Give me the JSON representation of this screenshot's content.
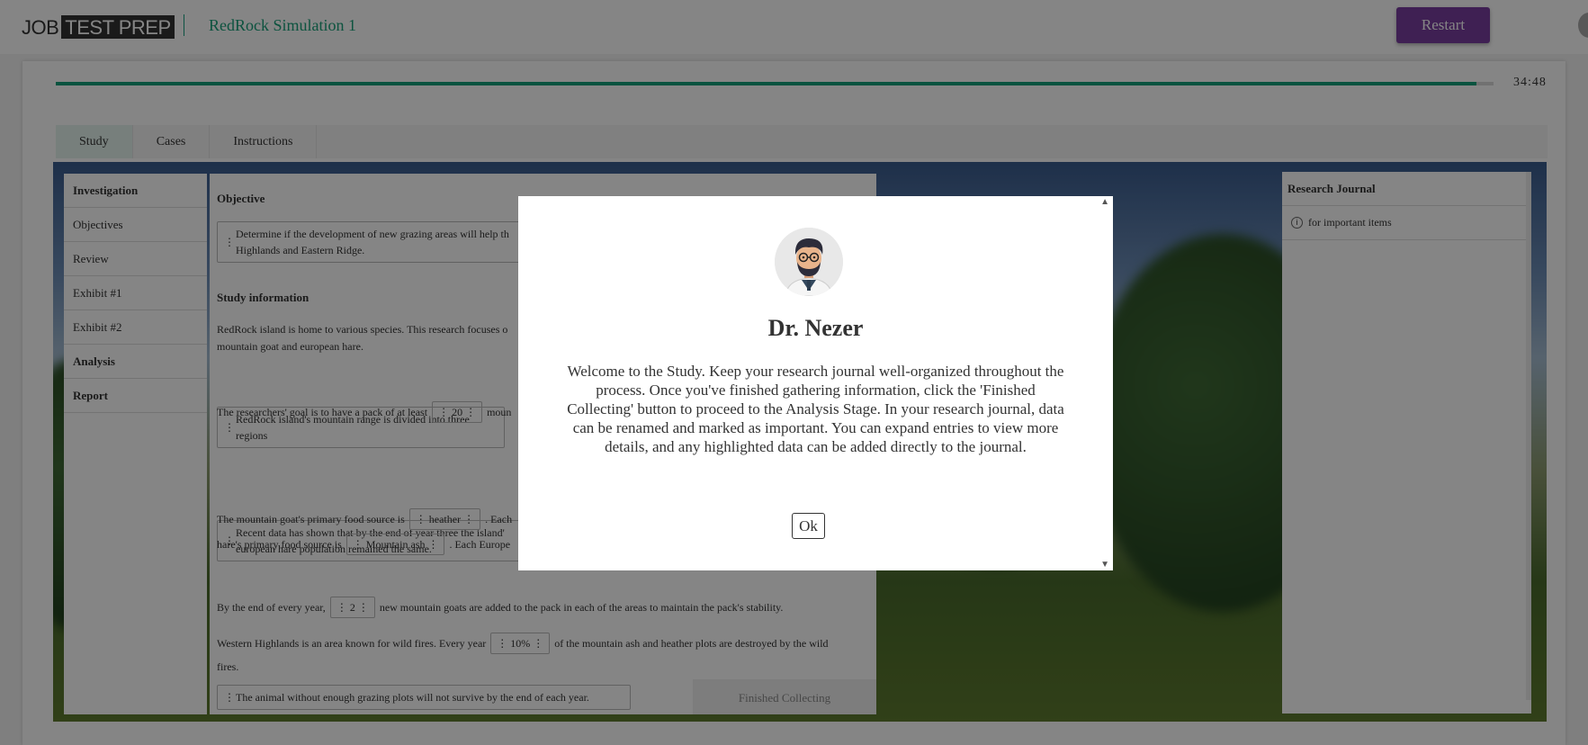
{
  "header": {
    "logo_part1": "JOB",
    "logo_part2": "TEST PREP",
    "app_title": "RedRock Simulation 1",
    "restart_label": "Restart"
  },
  "progress": {
    "fraction": 0.988,
    "timer": "34:48"
  },
  "tabs": [
    {
      "label": "Study",
      "active": true
    },
    {
      "label": "Cases"
    },
    {
      "label": "Instructions"
    }
  ],
  "leftnav": {
    "items": [
      {
        "label": "Investigation",
        "bold": true
      },
      {
        "label": "Objectives"
      },
      {
        "label": "Review"
      },
      {
        "label": "Exhibit #1"
      },
      {
        "label": "Exhibit #2"
      },
      {
        "label": "Analysis",
        "bold": true
      },
      {
        "label": "Report",
        "bold": true
      }
    ]
  },
  "content": {
    "objective_title": "Objective",
    "objective_text": "Determine if the development of new grazing areas will help th",
    "objective_text2": "Highlands and Eastern Ridge.",
    "study_title": "Study information",
    "study_p1a": "RedRock island is home to various species. This research focuses o",
    "study_p1b": "mountain goat and european hare.",
    "box_range": "RedRock island's mountain range is divided into three regions",
    "goal_pre": "The researchers' goal is to have a pack of at least",
    "goal_val": "20",
    "goal_post": "moun",
    "recent_a": "Recent data has shown that by the end of year three the island'",
    "recent_b": "european hare population remained the same.",
    "food_pre": "The mountain goat's primary food source is",
    "food_val": "heather",
    "food_post": ". Each",
    "hare_pre": "hare's primary food source is",
    "hare_val": "Mountain ash",
    "hare_post": ". Each Europe",
    "survive": "The animal without enough grazing plots will not survive by the end of each year.",
    "added_pre": "By the end of every year,",
    "added_val": "2",
    "added_post": "new mountain goats are added to the pack in each of the areas to maintain the pack's stability.",
    "fires_pre": "Western Highlands is an area known for wild fires. Every year",
    "fires_val": "10%",
    "fires_post": "of the mountain ash and heather plots are destroyed by the wild",
    "fires_post2": "fires.",
    "finished_label": "Finished Collecting"
  },
  "journal": {
    "title": "Research Journal",
    "hint": "for important items",
    "hint_icon": "info-icon"
  },
  "modal": {
    "name": "Dr. Nezer",
    "text": "Welcome to the Study. Keep your research journal well-organized throughout the process. Once you've finished gathering information, click the 'Finished Collecting' button to proceed to the Analysis Stage. In your research journal, data can be renamed and marked as important. You can expand entries to view more details, and any highlighted data can be added directly to the journal.",
    "ok_label": "Ok",
    "scroll_up": "▲",
    "scroll_down": "▼"
  }
}
